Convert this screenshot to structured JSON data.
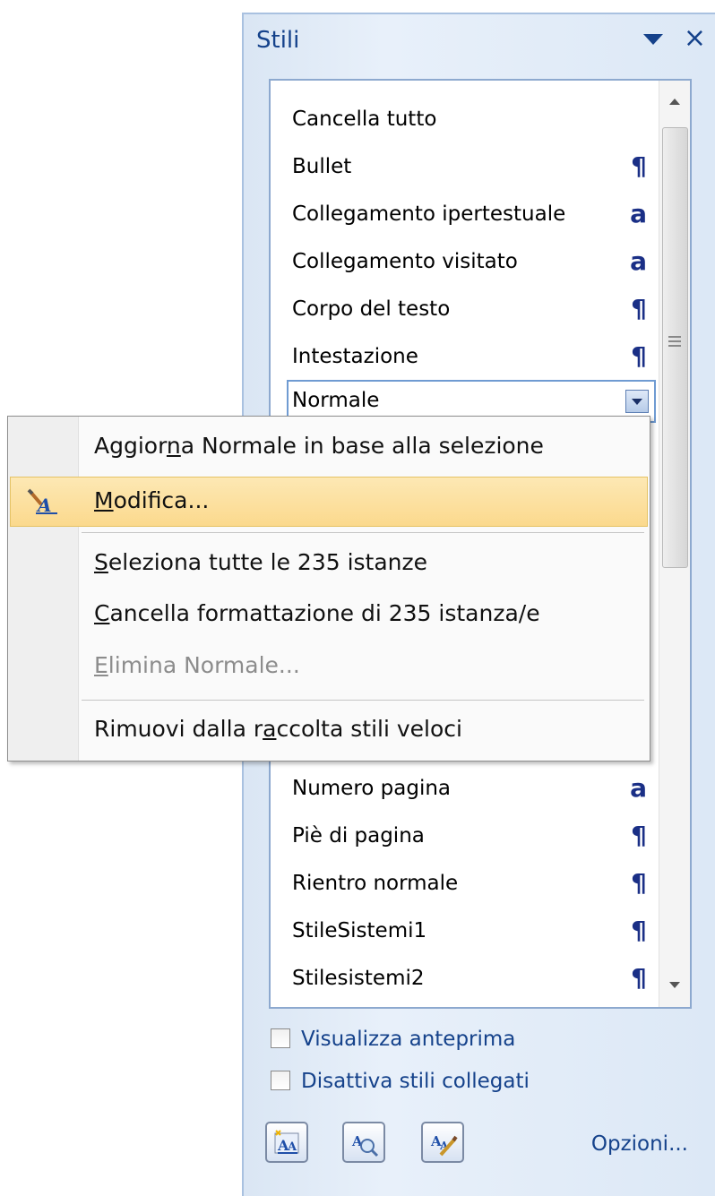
{
  "pane": {
    "title": "Stili",
    "dropdown_icon": "triangle-down-icon",
    "close_label": "×"
  },
  "styles": [
    {
      "name": "Cancella tutto",
      "mark": ""
    },
    {
      "name": "Bullet",
      "mark": "¶"
    },
    {
      "name": "Collegamento ipertestuale",
      "mark": "a"
    },
    {
      "name": "Collegamento visitato",
      "mark": "a"
    },
    {
      "name": "Corpo del testo",
      "mark": "¶"
    },
    {
      "name": "Intestazione",
      "mark": "¶"
    },
    {
      "name": "Normale",
      "mark": "",
      "selected": true
    },
    {
      "name": "Numero pagina",
      "mark": "a"
    },
    {
      "name": "Piè di pagina",
      "mark": "¶"
    },
    {
      "name": "Rientro normale",
      "mark": "¶"
    },
    {
      "name": "StileSistemi1",
      "mark": "¶"
    },
    {
      "name": "Stilesistemi2",
      "mark": "¶"
    }
  ],
  "context_menu": {
    "items": [
      {
        "pre": "Aggior",
        "key": "n",
        "post": "a Normale in base alla selezione"
      },
      {
        "pre": "",
        "key": "M",
        "post": "odifica...",
        "highlighted": true,
        "icon": "modify-style-icon"
      },
      {
        "pre": "",
        "key": "S",
        "post": "eleziona tutte le 235 istanze"
      },
      {
        "pre": "",
        "key": "C",
        "post": "ancella formattazione di 235 istanza/e"
      },
      {
        "pre": "",
        "key": "E",
        "post": "limina Normale...",
        "disabled": true
      },
      {
        "pre": "Rimuovi dalla r",
        "key": "a",
        "post": "ccolta stili veloci"
      }
    ]
  },
  "options": {
    "show_preview": "Visualizza anteprima",
    "disable_linked": "Disattiva stili collegati",
    "show_preview_checked": false,
    "disable_linked_checked": false
  },
  "toolbar": {
    "new_style_icon": "new-style-icon",
    "style_inspector_icon": "style-inspector-icon",
    "manage_styles_icon": "manage-styles-icon",
    "options_link": "Opzioni..."
  },
  "colors": {
    "pane_title": "#15428b",
    "paragraph_mark": "#1a2f86",
    "menu_highlight": "#fbd98d"
  }
}
